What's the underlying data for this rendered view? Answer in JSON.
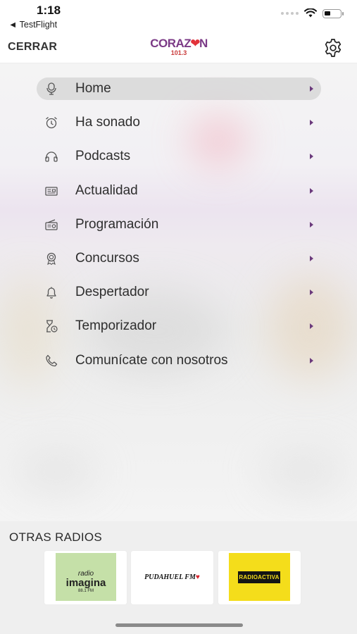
{
  "status_bar": {
    "time": "1:18",
    "back_app": "◄ TestFlight"
  },
  "header": {
    "close_label": "CERRAR",
    "logo_text_before": "CORAZ",
    "logo_heart": "❤",
    "logo_text_after": "N",
    "logo_frequency": "101.3"
  },
  "menu": {
    "items": [
      {
        "label": "Home",
        "icon": "microphone-icon",
        "active": true
      },
      {
        "label": "Ha sonado",
        "icon": "alarm-clock-icon"
      },
      {
        "label": "Podcasts",
        "icon": "headphones-icon"
      },
      {
        "label": " Actualidad",
        "icon": "newspaper-icon"
      },
      {
        "label": "Programación",
        "icon": "radio-icon"
      },
      {
        "label": "Concursos",
        "icon": "award-ribbon-icon"
      },
      {
        "label": "Despertador",
        "icon": "bell-icon"
      },
      {
        "label": "Temporizador",
        "icon": "hourglass-timer-icon"
      },
      {
        "label": "Comunícate con nosotros",
        "icon": "phone-icon"
      }
    ]
  },
  "other_radios": {
    "title": "OTRAS RADIOS",
    "cards": [
      {
        "small": "radio",
        "name": "imagina",
        "freq": "88.1 FM"
      },
      {
        "name": "PUDAHUEL FM",
        "heart": "♥"
      },
      {
        "name": "RADIOACTIVA"
      }
    ]
  },
  "colors": {
    "brand_purple": "#7b3a86",
    "brand_red": "#e2333b",
    "chevron": "#6b3a7c",
    "imagina_green": "#c5e0a8",
    "activa_yellow": "#f4dd1b"
  }
}
